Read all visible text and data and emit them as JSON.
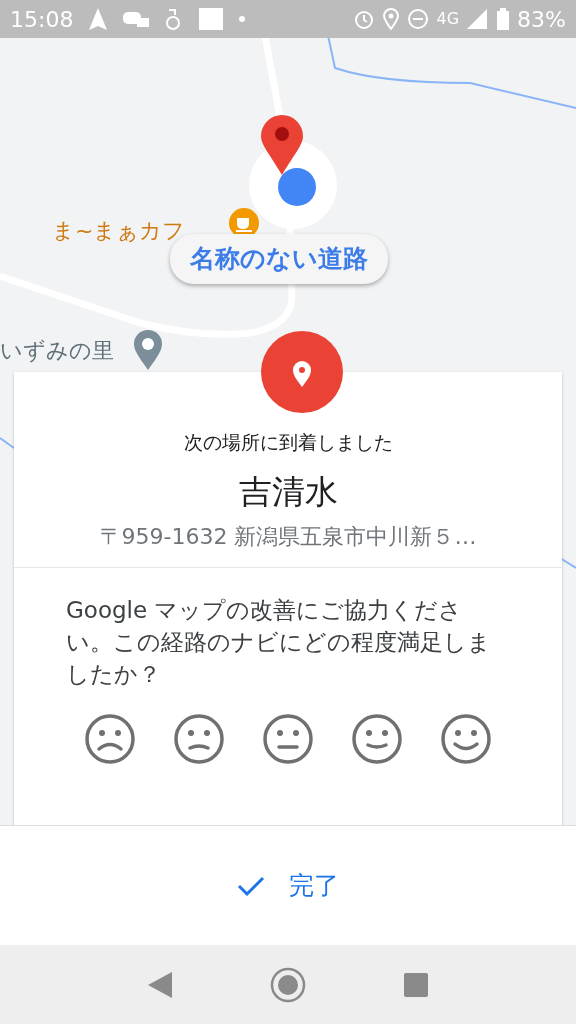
{
  "status_bar": {
    "time": "15:08",
    "network": "4G",
    "battery": "83%"
  },
  "map": {
    "labels": [
      {
        "text": "ま~まぁカフ",
        "kind": "cafe"
      },
      {
        "text": "名称のない道路",
        "kind": "road"
      },
      {
        "text": "いずみの里",
        "kind": "place"
      }
    ]
  },
  "arrival_card": {
    "heading": "次の場所に到着しました",
    "place_name": "吉清水",
    "address": "〒959-1632 新潟県五泉市中川新５…",
    "question": "Google マップの改善にご協力ください。この経路のナビにどの程度満足しましたか？"
  },
  "done_button": {
    "label": "完了"
  }
}
